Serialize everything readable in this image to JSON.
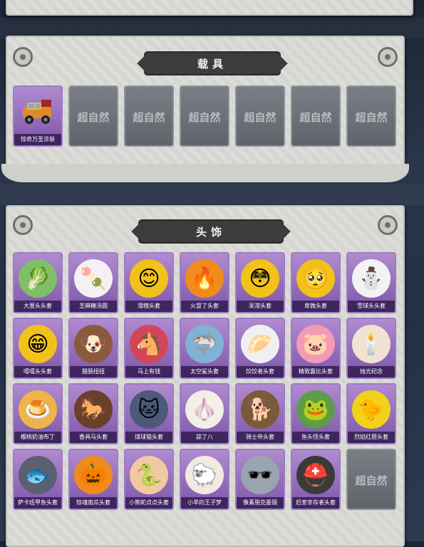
{
  "vehicles": {
    "title": "载具",
    "items": [
      {
        "label": "惊奇万圣涂装",
        "owned": true,
        "icon": "car"
      },
      {
        "label": "",
        "owned": false
      },
      {
        "label": "",
        "owned": false
      },
      {
        "label": "",
        "owned": false
      },
      {
        "label": "",
        "owned": false
      },
      {
        "label": "",
        "owned": false
      },
      {
        "label": "",
        "owned": false
      }
    ]
  },
  "headwear": {
    "title": "头饰",
    "items": [
      {
        "label": "大葱头头套",
        "owned": true,
        "icon": "🥬",
        "bg": "#7fbf6a"
      },
      {
        "label": "芝麻糖汤圆",
        "owned": true,
        "icon": "🍡",
        "bg": "#f4f1f4"
      },
      {
        "label": "滑稽头套",
        "owned": true,
        "icon": "😊",
        "bg": "#f2c21b"
      },
      {
        "label": "火冒了头套",
        "owned": true,
        "icon": "🔥",
        "bg": "#f08c1c"
      },
      {
        "label": "呆滞头套",
        "owned": true,
        "icon": "😳",
        "bg": "#f2c21b"
      },
      {
        "label": "卑微头套",
        "owned": true,
        "icon": "🥺",
        "bg": "#f2c21b"
      },
      {
        "label": "雪球头头套",
        "owned": true,
        "icon": "⛄",
        "bg": "#f3f3f3"
      },
      {
        "label": "嘻嘻头头套",
        "owned": true,
        "icon": "😁",
        "bg": "#f2c21b"
      },
      {
        "label": "腊肠扭扭",
        "owned": true,
        "icon": "🐶",
        "bg": "#8b5a3c"
      },
      {
        "label": "马上有钱",
        "owned": true,
        "icon": "🐴",
        "bg": "#d2465a"
      },
      {
        "label": "太空鲨头套",
        "owned": true,
        "icon": "🦈",
        "bg": "#7fb2d6"
      },
      {
        "label": "饺饺者头套",
        "owned": true,
        "icon": "🥟",
        "bg": "#f0f0f2"
      },
      {
        "label": "精致露比头套",
        "owned": true,
        "icon": "🐷",
        "bg": "#f29ab6"
      },
      {
        "label": "烛光纪念",
        "owned": true,
        "icon": "🕯️",
        "bg": "#f1e3d2"
      },
      {
        "label": "樱桃奶油布丁",
        "owned": true,
        "icon": "🍮",
        "bg": "#f0b34a"
      },
      {
        "label": "香具马头套",
        "owned": true,
        "icon": "🐎",
        "bg": "#6b3f2a"
      },
      {
        "label": "煤球猫头套",
        "owned": true,
        "icon": "🐱",
        "bg": "#4c5a78"
      },
      {
        "label": "蒜了八",
        "owned": true,
        "icon": "🧄",
        "bg": "#f2efe6"
      },
      {
        "label": "骑士帝头套",
        "owned": true,
        "icon": "🐕",
        "bg": "#7a5a3a"
      },
      {
        "label": "鱼头怪头套",
        "owned": true,
        "icon": "🐸",
        "bg": "#5e9c4a"
      },
      {
        "label": "烈焰红唇头套",
        "owned": true,
        "icon": "🐤",
        "bg": "#f2d21b"
      },
      {
        "label": "萨卡班甲鱼头套",
        "owned": true,
        "icon": "🐟",
        "bg": "#5a6070"
      },
      {
        "label": "惊魂南瓜头套",
        "owned": true,
        "icon": "🎃",
        "bg": "#f08a1c"
      },
      {
        "label": "小熊蛇点点头套",
        "owned": true,
        "icon": "🐍",
        "bg": "#f0c9a2"
      },
      {
        "label": "小羊的王子梦",
        "owned": true,
        "icon": "🐑",
        "bg": "#f2e9e2"
      },
      {
        "label": "像素朋克墨镜",
        "owned": true,
        "icon": "🕶️",
        "bg": "#9aa4b0"
      },
      {
        "label": "后室幸存者头套",
        "owned": true,
        "icon": "⛑️",
        "bg": "#3a3a3a"
      },
      {
        "label": "",
        "owned": false
      }
    ]
  },
  "locked_text": "超自然",
  "colors": {
    "owned_top": "#b08bd0",
    "owned_bottom": "#7d55a8",
    "locked": "#6a6f76",
    "banner": "#3c3c3c"
  }
}
